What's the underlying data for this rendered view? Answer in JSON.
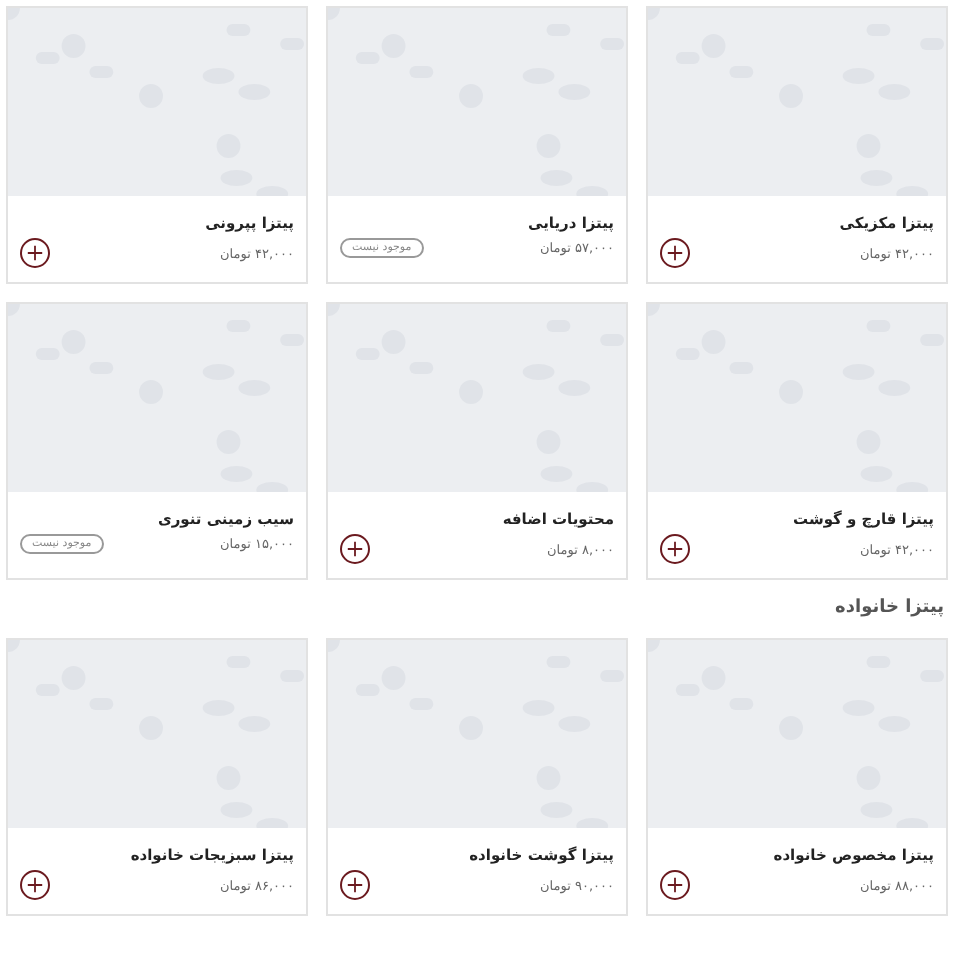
{
  "sections": [
    {
      "products": [
        {
          "name": "پیتزا مکزیکی",
          "price": "۴۲,۰۰۰ تومان",
          "available": true
        },
        {
          "name": "پیتزا دریایی",
          "price": "۵۷,۰۰۰ تومان",
          "available": false,
          "badge": "موجود نیست"
        },
        {
          "name": "پیتزا پپرونی",
          "price": "۴۲,۰۰۰ تومان",
          "available": true
        },
        {
          "name": "پیتزا قارچ و گوشت",
          "price": "۴۲,۰۰۰ تومان",
          "available": true
        },
        {
          "name": "محتویات اضافه",
          "price": "۸,۰۰۰ تومان",
          "available": true
        },
        {
          "name": "سیب زمینی تنوری",
          "price": "۱۵,۰۰۰ تومان",
          "available": false,
          "badge": "موجود نیست"
        }
      ]
    },
    {
      "title": "پیتزا خانواده",
      "products": [
        {
          "name": "پیتزا مخصوص خانواده",
          "price": "۸۸,۰۰۰ تومان",
          "available": true
        },
        {
          "name": "پیتزا گوشت خانواده",
          "price": "۹۰,۰۰۰ تومان",
          "available": true
        },
        {
          "name": "پیتزا سبزیجات خانواده",
          "price": "۸۶,۰۰۰ تومان",
          "available": true
        }
      ]
    }
  ]
}
